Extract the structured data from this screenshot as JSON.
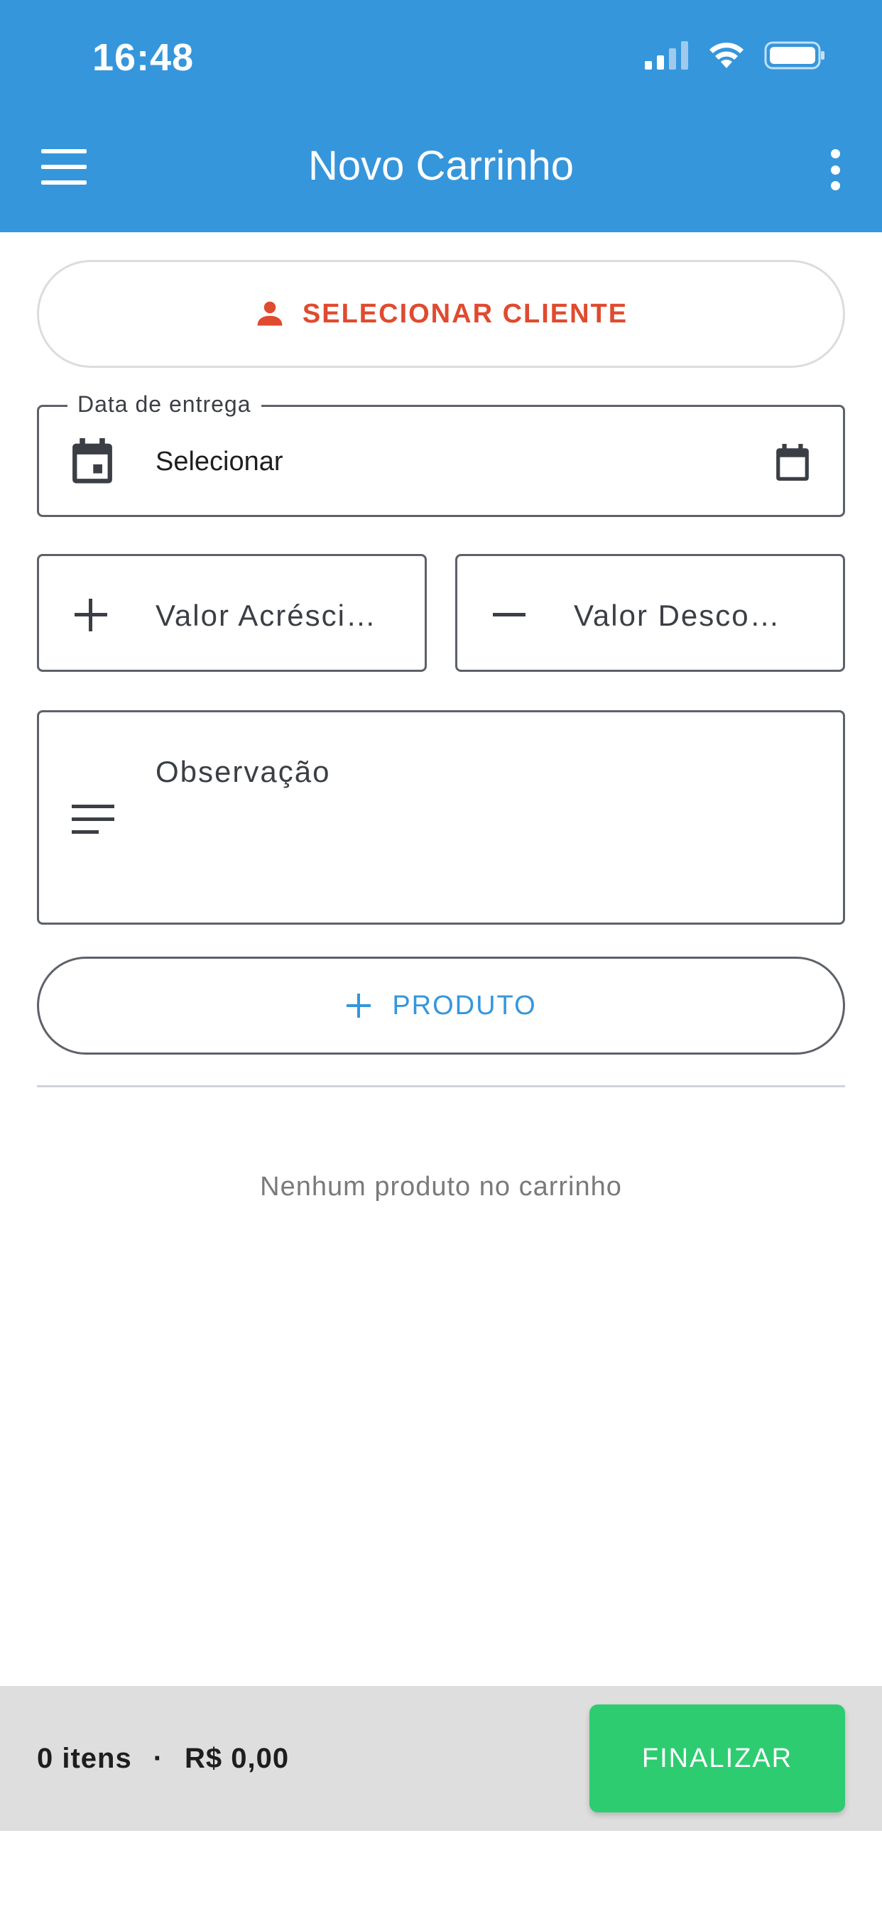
{
  "status_bar": {
    "time": "16:48"
  },
  "app_bar": {
    "title": "Novo Carrinho",
    "menu_icon": "hamburger-menu-icon",
    "more_icon": "more-vertical-icon",
    "color": "#3596dc"
  },
  "client": {
    "label": "SELECIONAR CLIENTE",
    "icon": "person-icon",
    "color": "#e04a2f"
  },
  "delivery_date": {
    "legend": "Data de entrega",
    "value": "Selecionar",
    "icon": "calendar-icon"
  },
  "surcharge": {
    "placeholder": "Valor Acrésci…",
    "icon": "plus-icon"
  },
  "discount": {
    "placeholder": "Valor Desco…",
    "icon": "minus-icon"
  },
  "observation": {
    "placeholder": "Observação",
    "icon": "notes-icon"
  },
  "add_product": {
    "label": "PRODUTO",
    "icon": "plus-icon",
    "color": "#3596dc"
  },
  "cart": {
    "empty_message": "Nenhum produto no carrinho"
  },
  "footer": {
    "items": "0 itens",
    "separator": "·",
    "total": "R$ 0,00",
    "finish_label": "FINALIZAR",
    "finish_color": "#2ecc71"
  }
}
